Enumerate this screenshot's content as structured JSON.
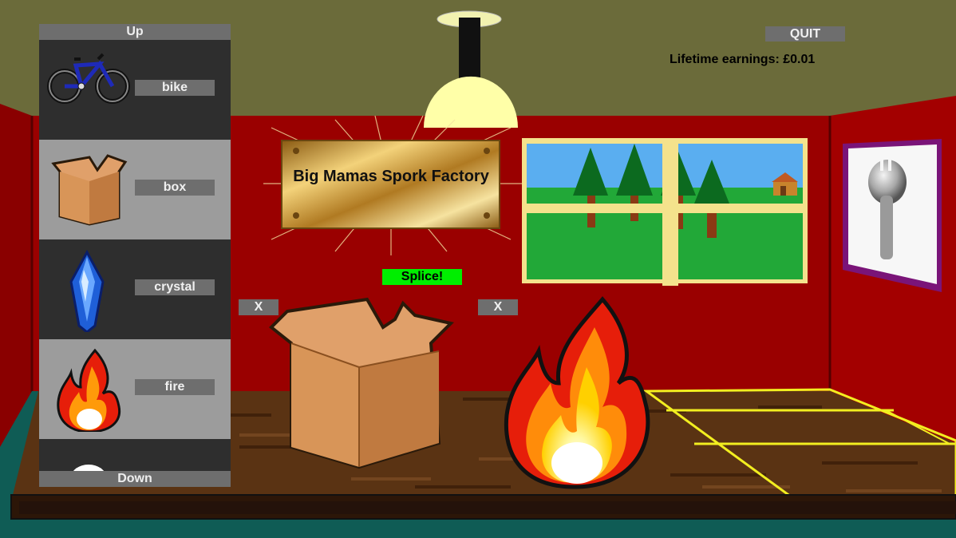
{
  "hud": {
    "quit_label": "QUIT",
    "earnings_text": "Lifetime earnings: £0.01"
  },
  "plaque": {
    "title": "Big Mamas Spork Factory"
  },
  "workbench": {
    "splice_label": "Splice!",
    "remove_label": "X",
    "left_slot": "box",
    "right_slot": "fire"
  },
  "inventory": {
    "up_label": "Up",
    "down_label": "Down",
    "items": [
      {
        "label": "bike",
        "icon": "bike-icon"
      },
      {
        "label": "box",
        "icon": "box-icon"
      },
      {
        "label": "crystal",
        "icon": "crystal-icon"
      },
      {
        "label": "fire",
        "icon": "fire-icon"
      },
      {
        "label": "",
        "icon": "egg-icon"
      }
    ]
  },
  "colors": {
    "wall": "#9a0000",
    "ceiling": "#6b6b3a",
    "splice_button": "#00ee00",
    "panel_dark": "#2e2e2e",
    "panel_light": "#9c9c9c",
    "button_gray": "#6e6e6e"
  }
}
